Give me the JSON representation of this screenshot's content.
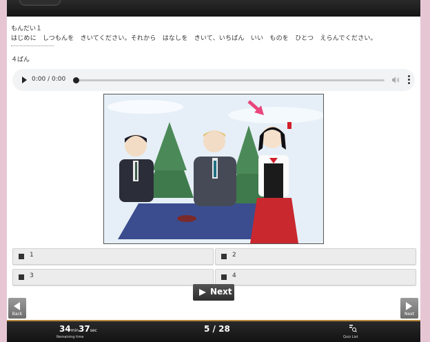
{
  "question": {
    "title": "もんだい１",
    "instruction": "はじめに　しつもんを　きいてください。それから　はなしを　きいて、いちばん　いい　ものを　ひとつ　えらんでください。",
    "number": "４ばん"
  },
  "audio": {
    "time": "0:00 / 0:00",
    "icons": [
      "play-icon",
      "volume-icon",
      "more-icon"
    ]
  },
  "options": [
    {
      "label": "1"
    },
    {
      "label": "2"
    },
    {
      "label": "3"
    },
    {
      "label": "4"
    }
  ],
  "nav": {
    "back_label": "Back",
    "next_label": "Next",
    "next_side_label": "Next"
  },
  "footer": {
    "timer_minutes": "34",
    "timer_min_unit": "min",
    "timer_seconds": "37",
    "timer_sec_unit": "sec",
    "timer_caption": "Remaining time",
    "progress": "5 / 28",
    "quiz_list_label": "Quiz List"
  },
  "colors": {
    "accent": "#b7853a",
    "background": "#e7c6d4",
    "arrow": "#e8467c"
  }
}
